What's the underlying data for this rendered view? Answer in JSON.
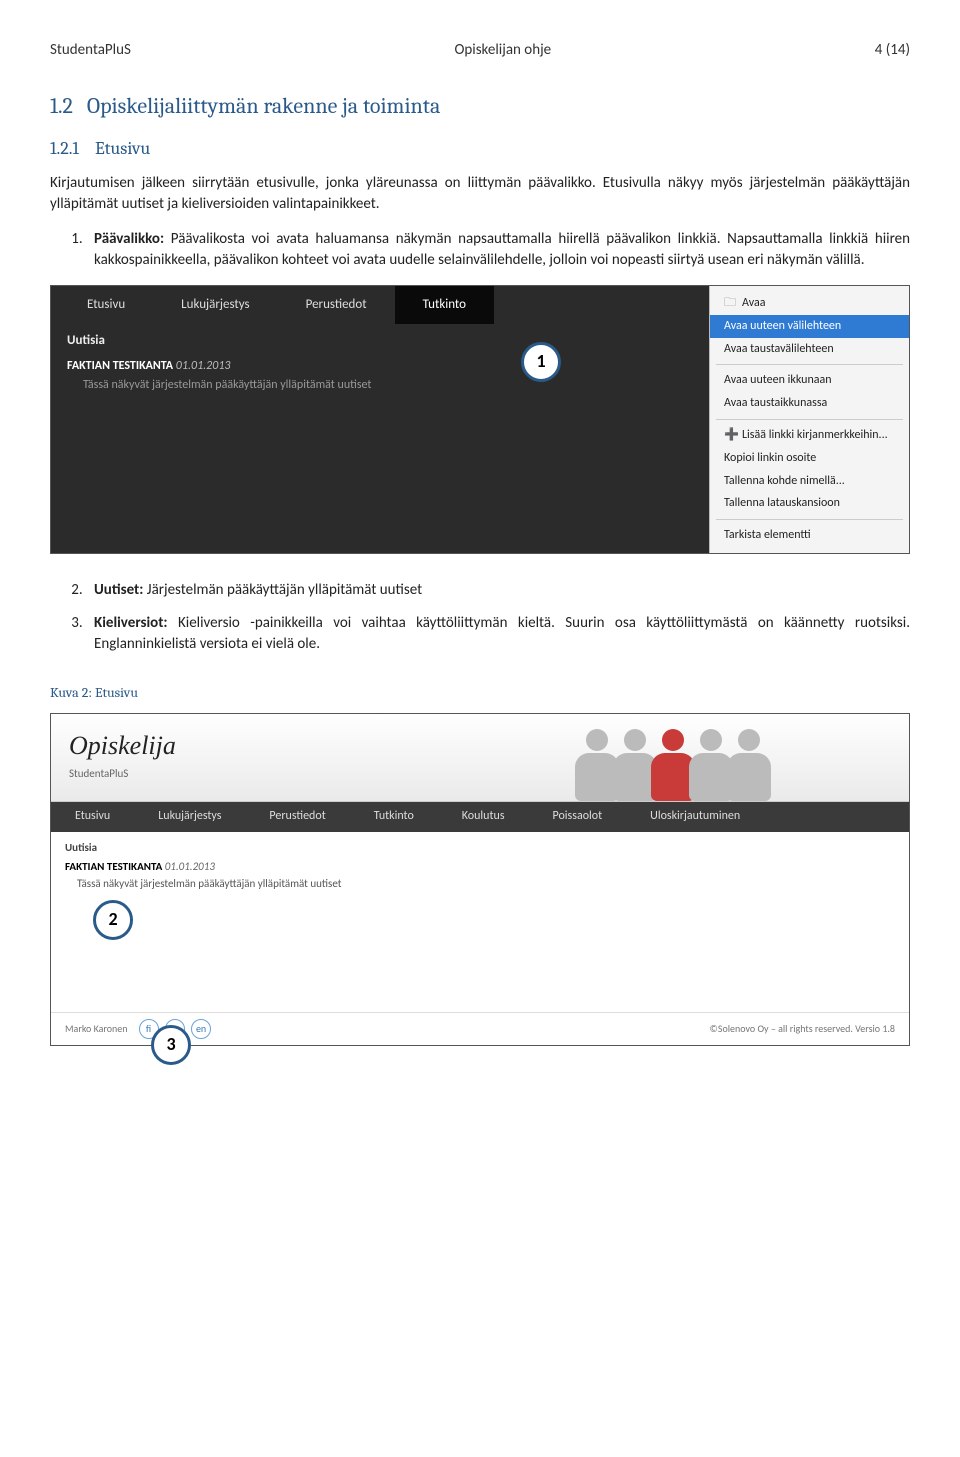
{
  "header": {
    "left": "StudentaPluS",
    "center": "Opiskelijan ohje",
    "right": "4 (14)"
  },
  "section": {
    "num": "1.2",
    "title": "Opiskelijaliittymän rakenne ja toiminta"
  },
  "sub": {
    "num": "1.2.1",
    "title": "Etusivu"
  },
  "intro": "Kirjautumisen jälkeen siirrytään etusivulle, jonka yläreunassa on liittymän päävalikko. Etusivulla näkyy myös järjestelmän pääkäyttäjän ylläpitämät uutiset ja kieliversioiden valintapainikkeet.",
  "item1": {
    "bold": "Päävalikko:",
    "text": " Päävalikosta voi avata haluamansa näkymän napsauttamalla hiirellä päävalikon linkkiä. Napsauttamalla linkkiä hiiren kakkospainikkeella, päävalikon kohteet voi avata uudelle selainvälilehdelle, jolloin voi nopeasti siirtyä usean eri näkymän välillä."
  },
  "shot1": {
    "nav": [
      "Etusivu",
      "Lukujärjestys",
      "Perustiedot",
      "Tutkinto"
    ],
    "active_index": 3,
    "uutisia": "Uutisia",
    "news_bold": "FAKTIAN TESTIKANTA",
    "news_date": "01.01.2013",
    "news_body": "Tässä näkyvät järjestelmän pääkäyttäjän ylläpitämät uutiset",
    "ctx": {
      "g1": [
        "Avaa",
        "Avaa uuteen välilehteen",
        "Avaa taustavälilehteen"
      ],
      "g1_sel_index": 1,
      "g2": [
        "Avaa uuteen ikkunaan",
        "Avaa taustaikkunassa"
      ],
      "g3": [
        "Lisää linkki kirjanmerkkeihin...",
        "Kopioi linkin osoite",
        "Tallenna kohde nimellä...",
        "Tallenna latauskansioon"
      ],
      "g4": [
        "Tarkista elementti"
      ]
    },
    "callout": "1"
  },
  "item2": {
    "bold": "Uutiset:",
    "text": " Järjestelmän pääkäyttäjän ylläpitämät uutiset"
  },
  "item3": {
    "bold": "Kieliversiot:",
    "text": " Kieliversio -painikkeilla voi vaihtaa käyttöliittymän kieltä. Suurin osa käyttöliittymästä on käännetty ruotsiksi. Englanninkielistä versiota ei vielä ole."
  },
  "fig_caption": "Kuva 2: Etusivu",
  "shot2": {
    "banner_title": "Opiskelija",
    "banner_sub": "StudentaPluS",
    "nav": [
      "Etusivu",
      "Lukujärjestys",
      "Perustiedot",
      "Tutkinto",
      "Koulutus",
      "Poissaolot",
      "Uloskirjautuminen"
    ],
    "news_title": "Uutisia",
    "news_bold": "FAKTIAN TESTIKANTA",
    "news_date": "01.01.2013",
    "news_body": "Tässä näkyvät järjestelmän pääkäyttäjän ylläpitämät uutiset",
    "callout2": "2",
    "callout3": "3",
    "footer_left": "Marko Karonen",
    "langs": [
      "fi",
      "sv",
      "en"
    ],
    "footer_right": "©Solenovo Oy – all rights reserved. Versio 1.8"
  }
}
